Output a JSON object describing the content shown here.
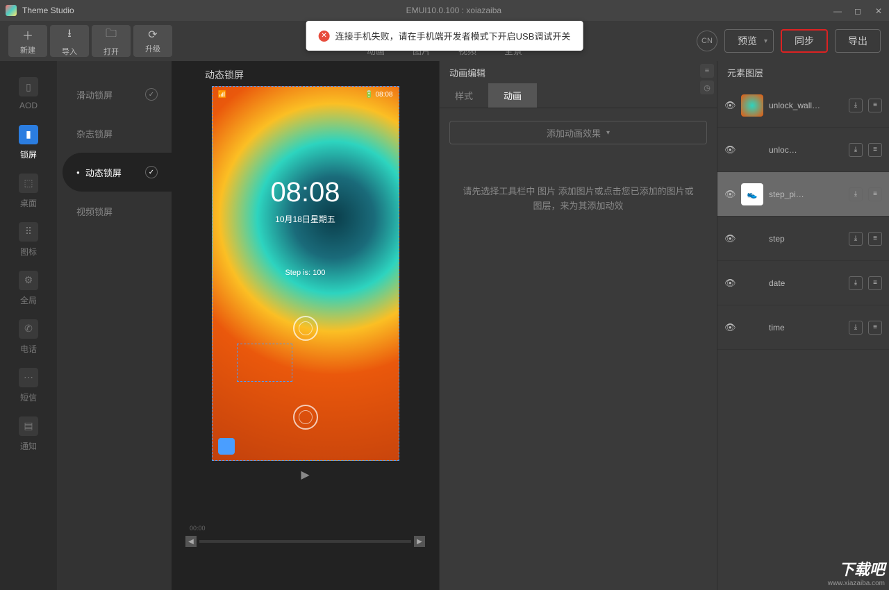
{
  "titlebar": {
    "app": "Theme Studio",
    "subtitle": "EMUI10.0.100 : xoiazaiba"
  },
  "toolbar": {
    "new": "新建",
    "import": "导入",
    "open": "打开",
    "upgrade": "升级",
    "tabs": {
      "anim": "动画",
      "image": "图片",
      "video": "视频",
      "pano": "全景"
    },
    "lang": "CN",
    "preview": "预览",
    "sync": "同步",
    "export": "导出"
  },
  "sidebar": {
    "aod": "AOD",
    "lock": "锁屏",
    "desktop": "桌面",
    "icon": "图标",
    "global": "全局",
    "phone": "电话",
    "sms": "短信",
    "notify": "通知"
  },
  "sublist": {
    "slide": "滑动锁屏",
    "magazine": "杂志锁屏",
    "dynamic": "动态锁屏",
    "video": "视频锁屏"
  },
  "canvas": {
    "title": "动态锁屏",
    "status_time": "08:08",
    "clock": "08:08",
    "date": "10月18日星期五",
    "step": "Step is: 100",
    "timeline_zero": "00:00"
  },
  "editor": {
    "title": "动画编辑",
    "tab_style": "样式",
    "tab_anim": "动画",
    "add_effect": "添加动画效果",
    "hint": "请先选择工具栏中 图片 添加图片或点击您已添加的图片或图层，来为其添加动效"
  },
  "layers": {
    "title": "元素图层",
    "items": [
      {
        "name": "unlock_wall…"
      },
      {
        "name": "unloc…"
      },
      {
        "name": "step_pi…"
      },
      {
        "name": "step"
      },
      {
        "name": "date"
      },
      {
        "name": "time"
      }
    ]
  },
  "toast": "连接手机失败，请在手机端开发者模式下开启USB调试开关",
  "watermark": {
    "big": "下载吧",
    "url": "www.xiazaiba.com"
  }
}
